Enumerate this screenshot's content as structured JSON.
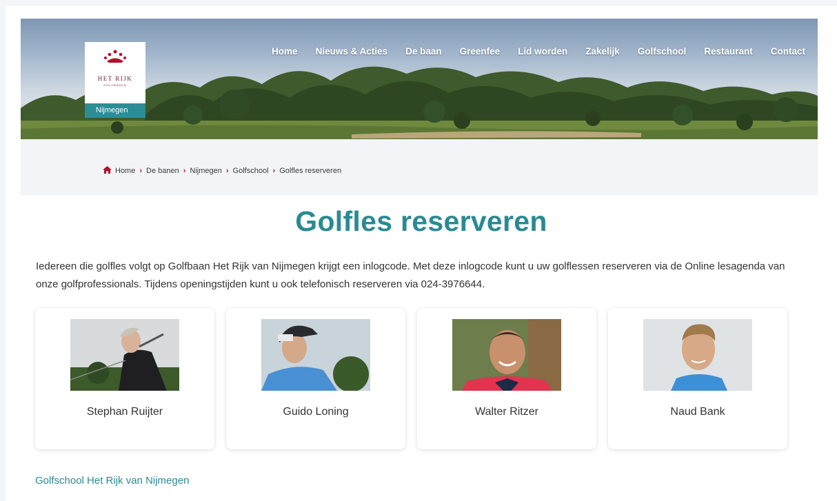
{
  "brand": {
    "logo_name": "HET RIJK",
    "logo_sub": "GOLFBANEN",
    "location": "Nijmegen",
    "accent": "#2a8a93",
    "crumb_color": "#b0122d"
  },
  "nav": {
    "items": [
      "Home",
      "Nieuws & Acties",
      "De baan",
      "Greenfee",
      "Lid worden",
      "Zakelijk",
      "Golfschool",
      "Restaurant",
      "Contact"
    ]
  },
  "breadcrumb": {
    "items": [
      "Home",
      "De banen",
      "Nijmegen",
      "Golfschool",
      "Golfles reserveren"
    ]
  },
  "page": {
    "title": "Golfles reserveren",
    "intro": "Iedereen die golfles volgt op Golfbaan Het Rijk van Nijmegen krijgt een inlogcode. Met deze inlogcode kunt u uw golflessen reserveren via de Online lesagenda van onze golfprofessionals. Tijdens openingstijden kunt u ook telefonisch reserveren via 024-3976644.",
    "footer_link": "Golfschool Het Rijk van Nijmegen"
  },
  "pros": [
    {
      "name": "Stephan Ruijter"
    },
    {
      "name": "Guido Loning"
    },
    {
      "name": "Walter Ritzer"
    },
    {
      "name": "Naud Bank"
    }
  ]
}
